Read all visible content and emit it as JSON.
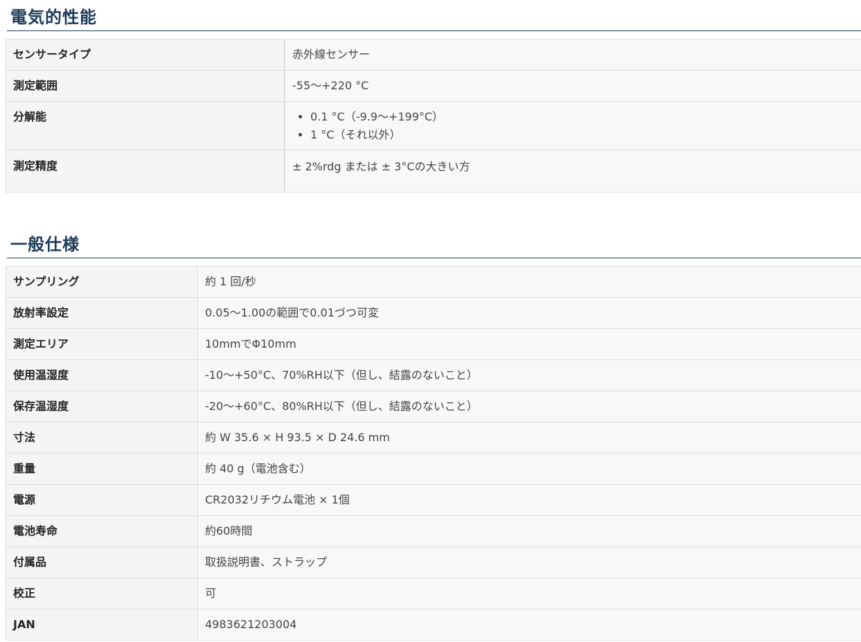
{
  "electrical": {
    "title": "電気的性能",
    "rows": [
      {
        "label": "センサータイプ",
        "value": "赤外線センサー"
      },
      {
        "label": "測定範囲",
        "value": "-55～+220 °C"
      },
      {
        "label": "分解能",
        "items": [
          "0.1 °C（-9.9～+199°C）",
          "1 °C（それ以外）"
        ]
      },
      {
        "label": "測定精度",
        "value": "± 2%rdg または ± 3°Cの大きい方"
      }
    ]
  },
  "general": {
    "title": "一般仕様",
    "rows": [
      {
        "label": "サンプリング",
        "value": "約 1 回/秒"
      },
      {
        "label": "放射率設定",
        "value": "0.05～1.00の範囲で0.01づつ可変"
      },
      {
        "label": "測定エリア",
        "value": "10mmでΦ10mm"
      },
      {
        "label": "使用温湿度",
        "value": "-10～+50°C、70%RH以下（但し、結露のないこと）"
      },
      {
        "label": "保存温湿度",
        "value": "-20～+60°C、80%RH以下（但し、結露のないこと）"
      },
      {
        "label": "寸法",
        "value": "約 W 35.6 × H 93.5 × D 24.6 mm"
      },
      {
        "label": "重量",
        "value": "約 40 g（電池含む）"
      },
      {
        "label": "電源",
        "value": "CR2032リチウム電池 × 1個"
      },
      {
        "label": "電池寿命",
        "value": "約60時間"
      },
      {
        "label": "付属品",
        "value": "取扱説明書、ストラップ"
      },
      {
        "label": "校正",
        "value": "可"
      },
      {
        "label": "JAN",
        "value": "4983621203004"
      }
    ]
  }
}
